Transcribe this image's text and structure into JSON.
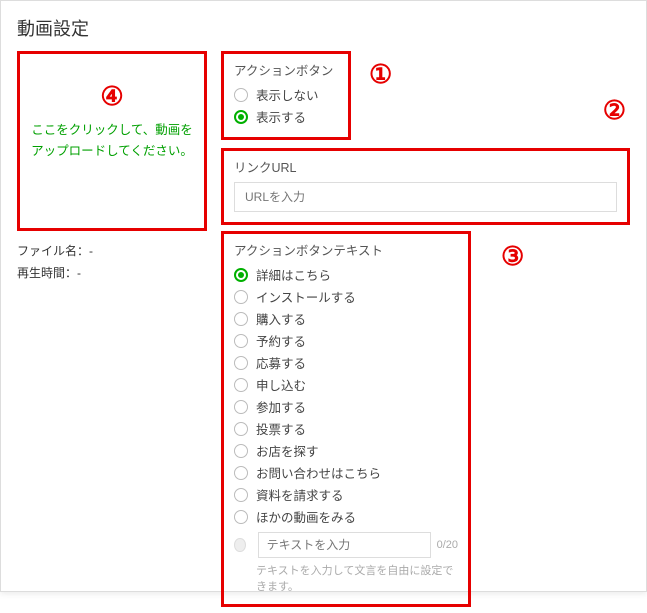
{
  "title": "動画設定",
  "badges": {
    "b1": "①",
    "b2": "②",
    "b3": "③",
    "b4": "④"
  },
  "left": {
    "upload_line1": "ここをクリックして、動画を",
    "upload_line2": "アップロードしてください。",
    "file_label": "ファイル名：",
    "file_value": "-",
    "duration_label": "再生時間：",
    "duration_value": "-"
  },
  "action_button": {
    "group_label": "アクションボタン",
    "options": {
      "hide": {
        "label": "表示しない",
        "selected": false
      },
      "show": {
        "label": "表示する",
        "selected": true
      }
    }
  },
  "link_url": {
    "group_label": "リンクURL",
    "placeholder": "URLを入力",
    "value": ""
  },
  "button_text": {
    "group_label": "アクションボタンテキスト",
    "options": [
      {
        "label": "詳細はこちら",
        "selected": true
      },
      {
        "label": "インストールする",
        "selected": false
      },
      {
        "label": "購入する",
        "selected": false
      },
      {
        "label": "予約する",
        "selected": false
      },
      {
        "label": "応募する",
        "selected": false
      },
      {
        "label": "申し込む",
        "selected": false
      },
      {
        "label": "参加する",
        "selected": false
      },
      {
        "label": "投票する",
        "selected": false
      },
      {
        "label": "お店を探す",
        "selected": false
      },
      {
        "label": "お問い合わせはこちら",
        "selected": false
      },
      {
        "label": "資料を請求する",
        "selected": false
      },
      {
        "label": "ほかの動画をみる",
        "selected": false
      }
    ],
    "custom": {
      "placeholder": "テキストを入力",
      "value": "",
      "counter": "0/20",
      "hint": "テキストを入力して文言を自由に設定できます。"
    }
  }
}
